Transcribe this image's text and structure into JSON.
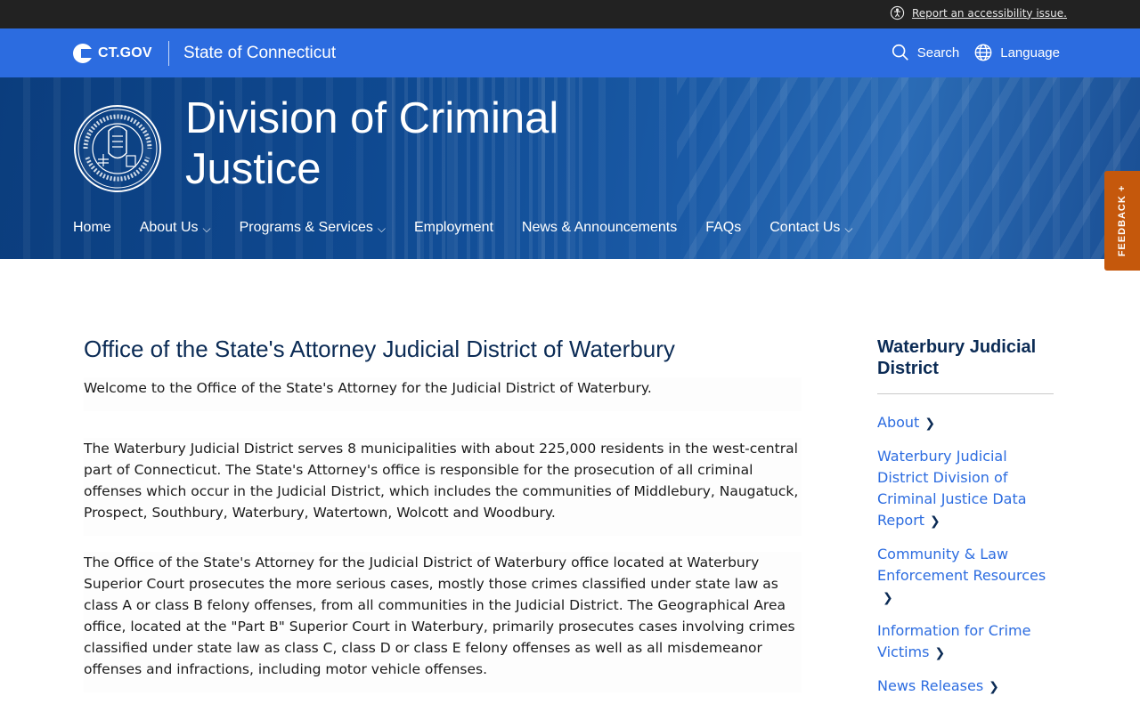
{
  "utility": {
    "accessibility_link": "Report an accessibility issue."
  },
  "ctgov": {
    "logo_text": "CT.GOV",
    "state_name": "State of Connecticut",
    "search_label": "Search",
    "language_label": "Language"
  },
  "hero": {
    "agency_title_line1": "Division of Criminal",
    "agency_title_line2": "Justice",
    "nav": [
      {
        "label": "Home",
        "has_dropdown": false
      },
      {
        "label": "About Us",
        "has_dropdown": true
      },
      {
        "label": "Programs & Services",
        "has_dropdown": true
      },
      {
        "label": "Employment",
        "has_dropdown": false
      },
      {
        "label": "News & Announcements",
        "has_dropdown": false
      },
      {
        "label": "FAQs",
        "has_dropdown": false
      },
      {
        "label": "Contact Us",
        "has_dropdown": true
      }
    ]
  },
  "feedback": {
    "label": "FEEDBACK +"
  },
  "main": {
    "title": "Office of the State's Attorney Judicial District of Waterbury",
    "paragraphs": [
      "Welcome to the Office of the State's Attorney for the Judicial District of Waterbury.",
      "The Waterbury Judicial District serves 8 municipalities with about 225,000 residents in the west-central part of Connecticut. The State's Attorney's office is responsible for the prosecution of all criminal offenses which occur in the Judicial District, which includes the communities of Middlebury, Naugatuck, Prospect, Southbury, Waterbury, Watertown, Wolcott and Woodbury.",
      "The Office of the State's Attorney for the Judicial District of Waterbury office located at Waterbury Superior Court prosecutes the more serious cases, mostly those crimes classified under state law as class A or class B felony offenses, from all communities in the Judicial District. The Geographical Area office, located at the \"Part B\" Superior Court in Waterbury, primarily prosecutes cases involving crimes classified under state law as class C, class D or class E felony offenses as well as all misdemeanor offenses and infractions, including motor vehicle offenses."
    ]
  },
  "sidebar": {
    "title": "Waterbury Judicial District",
    "links": [
      {
        "label": "About"
      },
      {
        "label": "Waterbury Judicial District Division of Criminal Justice Data Report"
      },
      {
        "label": "Community & Law Enforcement Resources"
      },
      {
        "label": "Information for Crime Victims"
      },
      {
        "label": "News Releases"
      }
    ]
  },
  "colors": {
    "ctgov_blue": "#2c6ce0",
    "utility_bg": "#222222",
    "heading_navy": "#0b2b55",
    "feedback_orange": "#c5580c"
  }
}
